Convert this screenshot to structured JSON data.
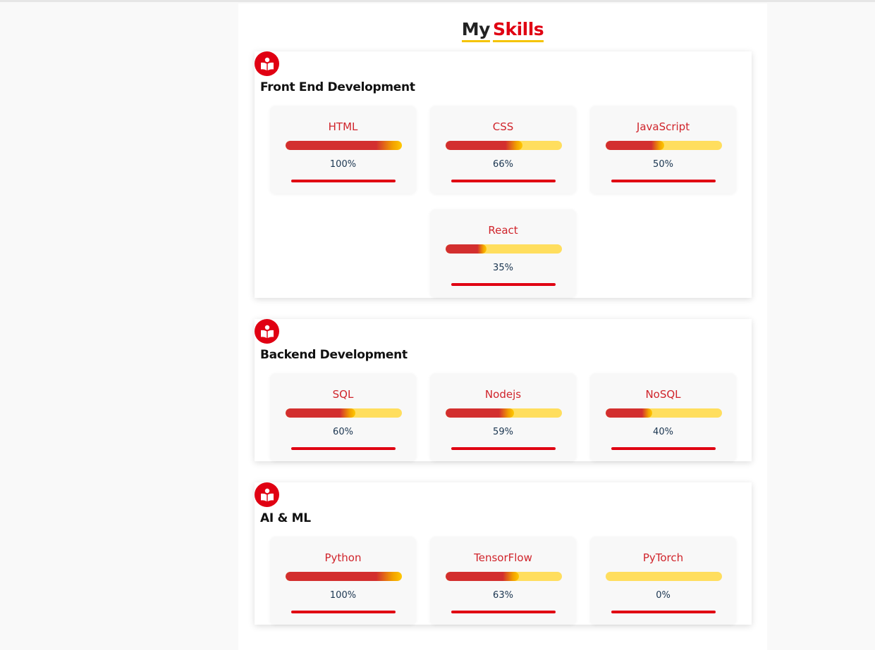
{
  "header": {
    "title_part1": "My",
    "title_part2": "Skills",
    "accent_color": "#e00012",
    "underline_color": "#f5c400"
  },
  "sections": [
    {
      "icon": "reader-book-icon",
      "title": "Front End Development",
      "skills": [
        {
          "name": "HTML",
          "percent_label": "100%",
          "level": 100
        },
        {
          "name": "CSS",
          "percent_label": "66%",
          "level": 66
        },
        {
          "name": "JavaScript",
          "percent_label": "50%",
          "level": 50
        },
        {
          "name": "React",
          "percent_label": "35%",
          "level": 35
        }
      ]
    },
    {
      "icon": "reader-book-icon",
      "title": "Backend Development",
      "skills": [
        {
          "name": "SQL",
          "percent_label": "60%",
          "level": 60
        },
        {
          "name": "Nodejs",
          "percent_label": "59%",
          "level": 59
        },
        {
          "name": "NoSQL",
          "percent_label": "40%",
          "level": 40
        }
      ]
    },
    {
      "icon": "reader-book-icon",
      "title": "AI & ML",
      "skills": [
        {
          "name": "Python",
          "percent_label": "100%",
          "level": 100
        },
        {
          "name": "TensorFlow",
          "percent_label": "63%",
          "level": 63
        },
        {
          "name": "PyTorch",
          "percent_label": "0%",
          "level": 0
        }
      ]
    }
  ]
}
